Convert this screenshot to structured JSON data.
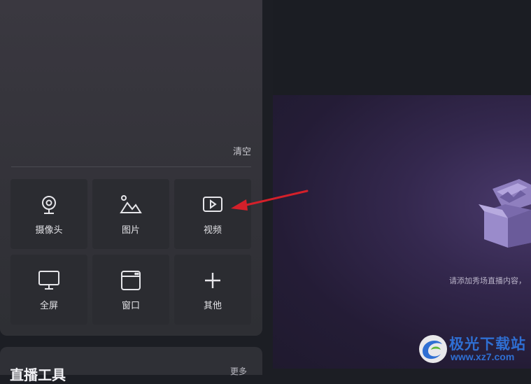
{
  "sources": {
    "clear_label": "清空"
  },
  "tiles": [
    {
      "label": "摄像头",
      "icon": "camera-icon"
    },
    {
      "label": "图片",
      "icon": "image-icon"
    },
    {
      "label": "视频",
      "icon": "video-icon"
    },
    {
      "label": "全屏",
      "icon": "monitor-icon"
    },
    {
      "label": "窗口",
      "icon": "window-icon"
    },
    {
      "label": "其他",
      "icon": "plus-icon"
    }
  ],
  "bottom_panel": {
    "title": "直播工具",
    "right_text": "更多"
  },
  "stage": {
    "empty_text": "请添加秀场直播内容，"
  },
  "watermark": {
    "name": "极光下载站",
    "url": "www.xz7.com"
  },
  "colors": {
    "annotation_arrow": "#d4202a",
    "watermark_blue": "#2f6fd3"
  }
}
